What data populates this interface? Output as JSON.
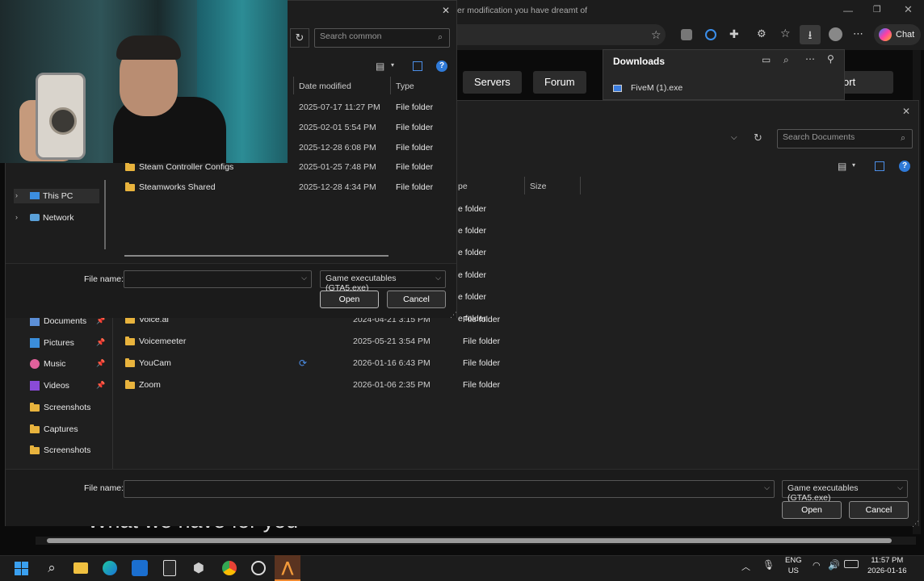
{
  "browser": {
    "page_text_top": "er modification you have dreamt of",
    "chat_label": "Chat",
    "nav": [
      "Servers",
      "Forum",
      "ort"
    ],
    "big_text": "What we have for you",
    "downloads": {
      "title": "Downloads",
      "file": "FiveM (1).exe"
    }
  },
  "dialog_back": {
    "search_placeholder": "Search Documents",
    "col_type": "pe",
    "col_size": "Size",
    "types": [
      "e folder",
      "e folder",
      "e folder",
      "e folder",
      "e folder",
      "e folder"
    ],
    "sidebar": [
      {
        "label": "Documents",
        "pinned": true
      },
      {
        "label": "Pictures",
        "pinned": true
      },
      {
        "label": "Music",
        "pinned": true
      },
      {
        "label": "Videos",
        "pinned": true
      },
      {
        "label": "Screenshots",
        "pinned": false
      },
      {
        "label": "Captures",
        "pinned": false
      },
      {
        "label": "Screenshots",
        "pinned": false
      }
    ],
    "files": [
      {
        "name": "Voicemeeter",
        "date": "2025-05-21 3:54 PM",
        "type": "File folder"
      },
      {
        "name": "YouCam",
        "date": "2026-01-16 6:43 PM",
        "type": "File folder"
      },
      {
        "name": "Zoom",
        "date": "2026-01-06 2:35 PM",
        "type": "File folder"
      }
    ],
    "partial_file": "Voice.ai",
    "partial_date": "2024-04-21 3:15 PM",
    "partial_type": "File folder",
    "file_name_label": "File name:",
    "file_type": "Game executables (GTA5.exe)",
    "open": "Open",
    "cancel": "Cancel"
  },
  "dialog_front": {
    "search_placeholder": "Search common",
    "col_date": "Date modified",
    "col_type": "Type",
    "rows": [
      {
        "name": "",
        "date": "2025-07-17 11:27 PM",
        "type": "File folder"
      },
      {
        "name": "",
        "date": "2025-02-01 5:54 PM",
        "type": "File folder"
      },
      {
        "name": "",
        "date": "2025-12-28 6:08 PM",
        "type": "File folder"
      },
      {
        "name": "Steam Controller Configs",
        "date": "2025-01-25 7:48 PM",
        "type": "File folder"
      },
      {
        "name": "Steamworks Shared",
        "date": "2025-12-28 4:34 PM",
        "type": "File folder"
      }
    ],
    "nav": [
      {
        "label": "This PC"
      },
      {
        "label": "Network"
      }
    ],
    "file_name_label": "File name:",
    "file_type": "Game executables (GTA5.exe)",
    "open": "Open",
    "cancel": "Cancel"
  },
  "taskbar": {
    "lang1": "ENG",
    "lang2": "US",
    "time": "11:57 PM",
    "date": "2026-01-16"
  }
}
